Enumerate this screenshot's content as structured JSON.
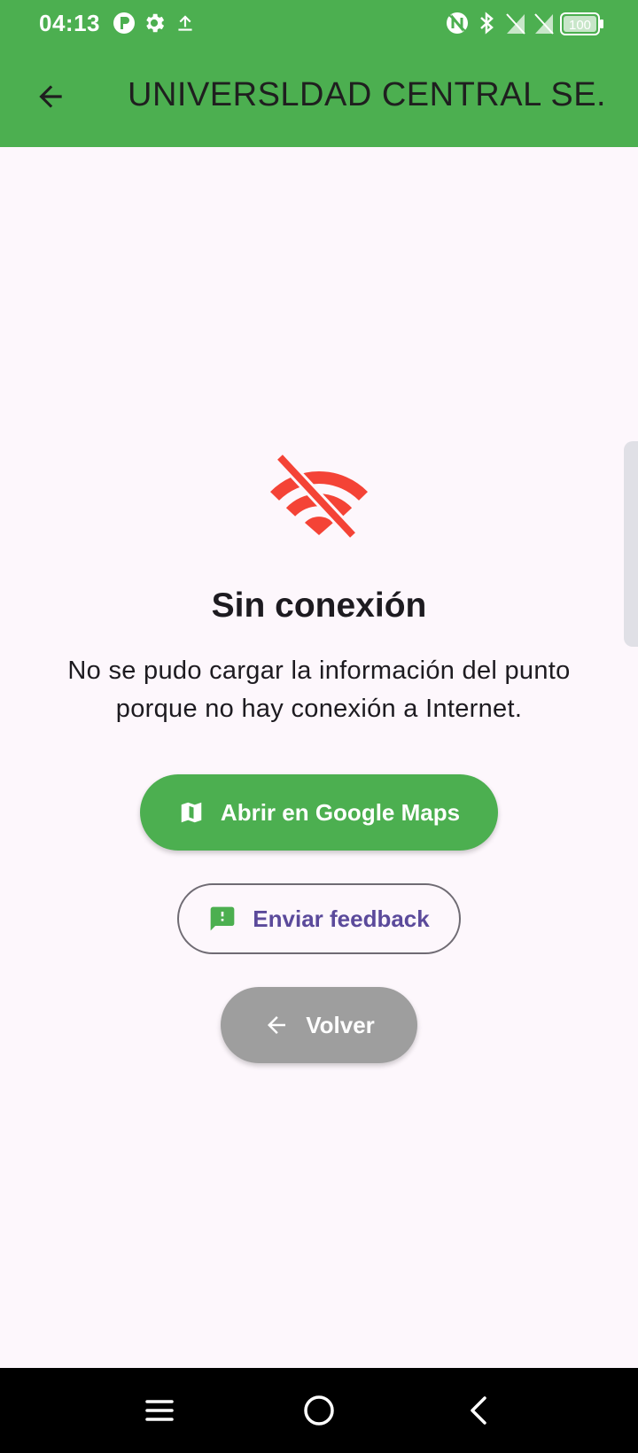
{
  "status_bar": {
    "time": "04:13",
    "left_icons": [
      "p-app-icon",
      "gear-icon",
      "upload-icon"
    ],
    "right_icons": [
      "nfc-icon",
      "bluetooth-icon",
      "no-sim-icon",
      "no-sim-icon",
      "battery-icon"
    ],
    "battery_level": "100"
  },
  "app_bar": {
    "title": "UNIVERSLDAD CENTRAL SE...",
    "back_icon": "arrow-back-icon"
  },
  "main": {
    "icon": "wifi-off-icon",
    "heading": "Sin conexión",
    "message": "No se pudo cargar la información del punto porque no hay conexión a Internet.",
    "buttons": {
      "maps_label": "Abrir en Google Maps",
      "feedback_label": "Enviar feedback",
      "back_label": "Volver"
    }
  },
  "nav_bar": {
    "buttons": [
      "menu-icon",
      "home-icon",
      "back-icon"
    ]
  },
  "colors": {
    "primary": "#4caf50",
    "error": "#f44336",
    "background": "#fdf7fc",
    "feedback_text": "#5b4a9b",
    "back_button": "#9e9e9e"
  }
}
